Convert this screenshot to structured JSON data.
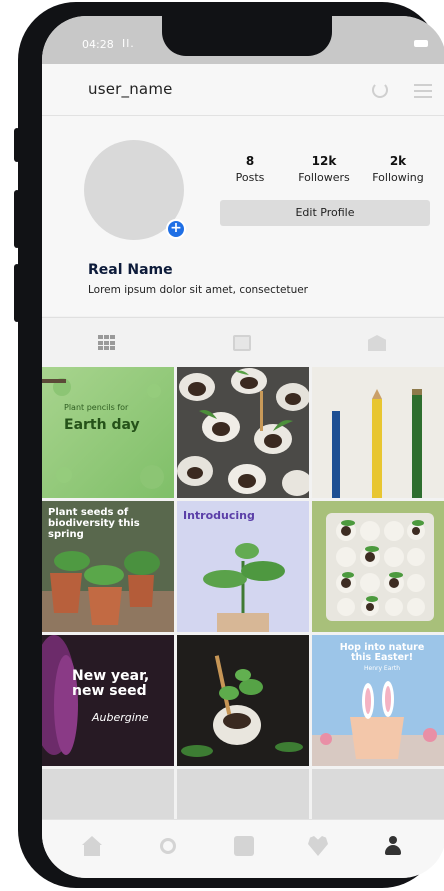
{
  "status_bar": {
    "time": "04:28",
    "signal": "Il."
  },
  "header": {
    "username": "user_name"
  },
  "profile": {
    "stats": [
      {
        "value": "8",
        "label": "Posts"
      },
      {
        "value": "12k",
        "label": "Followers"
      },
      {
        "value": "2k",
        "label": "Following"
      }
    ],
    "edit_button": "Edit Profile",
    "real_name": "Real Name",
    "bio": "Lorem ipsum dolor sit amet, consectetuer"
  },
  "tabs": [
    {
      "icon": "grid-icon"
    },
    {
      "icon": "tv-icon"
    },
    {
      "icon": "tagged-icon"
    }
  ],
  "posts": [
    {
      "caption_small": "Plant pencils for",
      "caption_big": "Earth day"
    },
    {
      "caption_small": "",
      "caption_big": ""
    },
    {
      "caption_small": "",
      "caption_big": ""
    },
    {
      "caption_small": "",
      "caption_big": "Plant seeds of biodiversity this spring"
    },
    {
      "caption_small": "",
      "caption_big": "Introducing"
    },
    {
      "caption_small": "",
      "caption_big": ""
    },
    {
      "caption_small": "Aubergine",
      "caption_big": "New year, new seed"
    },
    {
      "caption_small": "",
      "caption_big": ""
    },
    {
      "caption_small": "Henry Earth",
      "caption_big": "Hop into nature this Easter!"
    }
  ],
  "bottom_nav": [
    {
      "icon": "home-icon"
    },
    {
      "icon": "search-icon"
    },
    {
      "icon": "add-post-icon"
    },
    {
      "icon": "heart-icon"
    },
    {
      "icon": "profile-icon"
    }
  ],
  "colors": {
    "accent_blue": "#1f6fe5",
    "name_navy": "#0d1b3a"
  }
}
